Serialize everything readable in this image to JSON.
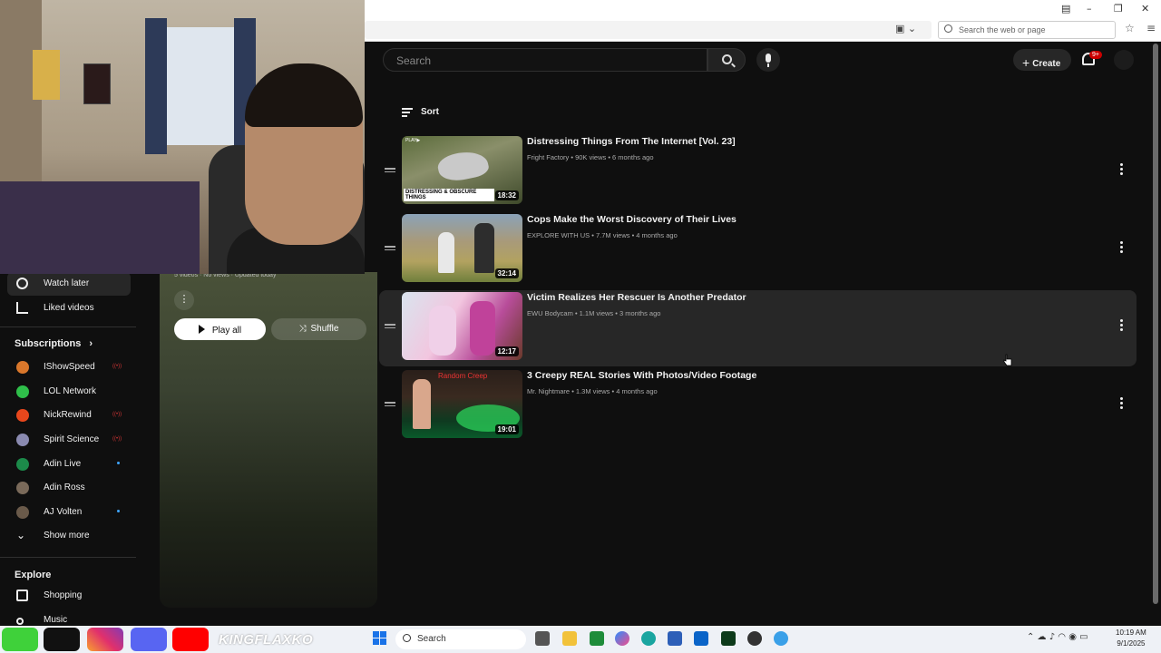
{
  "browser": {
    "web_search_placeholder": "Search the web or page"
  },
  "topbar": {
    "search_placeholder": "Search",
    "create_label": "Create",
    "notifications_badge": "9+"
  },
  "sidebar": {
    "items": [
      {
        "label": "Watch later",
        "icon": "clock-icon",
        "active": true
      },
      {
        "label": "Liked videos",
        "icon": "thumbs-up-icon",
        "active": false
      }
    ],
    "subscriptions_header": "Subscriptions",
    "subscriptions": [
      {
        "name": "IShowSpeed",
        "indicator": "live",
        "avatar_color": "#d9772b"
      },
      {
        "name": "LOL Network",
        "indicator": "none",
        "avatar_color": "#2fbf4a"
      },
      {
        "name": "NickRewind",
        "indicator": "live",
        "avatar_color": "#e8471c"
      },
      {
        "name": "Spirit Science",
        "indicator": "live",
        "avatar_color": "#8a8ab0"
      },
      {
        "name": "Adin Live",
        "indicator": "dot",
        "avatar_color": "#1c8a4a"
      },
      {
        "name": "Adin Ross",
        "indicator": "none",
        "avatar_color": "#7a6a5a"
      },
      {
        "name": "AJ Volten",
        "indicator": "dot",
        "avatar_color": "#6a5a4a"
      }
    ],
    "show_more": "Show more",
    "explore_header": "Explore",
    "explore_items": [
      {
        "label": "Shopping",
        "icon": "shopping-bag-icon"
      },
      {
        "label": "Music",
        "icon": "music-note-icon"
      }
    ]
  },
  "playlist": {
    "meta": "5 videos · No views · Updated today",
    "play_all": "Play all",
    "shuffle": "Shuffle"
  },
  "list": {
    "sort_label": "Sort",
    "videos": [
      {
        "title": "Distressing Things From The Internet [Vol. 23]",
        "channel": "Fright Factory",
        "views": "90K views",
        "age": "6 months ago",
        "duration": "18:32",
        "thumb_caption": "DISTRESSING & OBSCURE THINGS",
        "thumb_tag": "PLAY▶"
      },
      {
        "title": "Cops Make the Worst Discovery of Their Lives",
        "channel": "EXPLORE WITH US",
        "views": "7.7M views",
        "age": "4 months ago",
        "duration": "32:14"
      },
      {
        "title": "Victim Realizes Her Rescuer Is Another Predator",
        "channel": "EWU Bodycam",
        "views": "1.1M views",
        "age": "3 months ago",
        "duration": "12:17"
      },
      {
        "title": "3 Creepy REAL Stories With Photos/Video Footage",
        "channel": "Mr. Nightmare",
        "views": "1.3M views",
        "age": "4 months ago",
        "duration": "19:01",
        "thumb_caption": "Random Creep"
      }
    ]
  },
  "taskbar": {
    "search_label": "Search",
    "time": "10:19 AM",
    "date": "9/1/2025"
  },
  "overlay": {
    "streamer_name": "KINGFLAXKO"
  }
}
